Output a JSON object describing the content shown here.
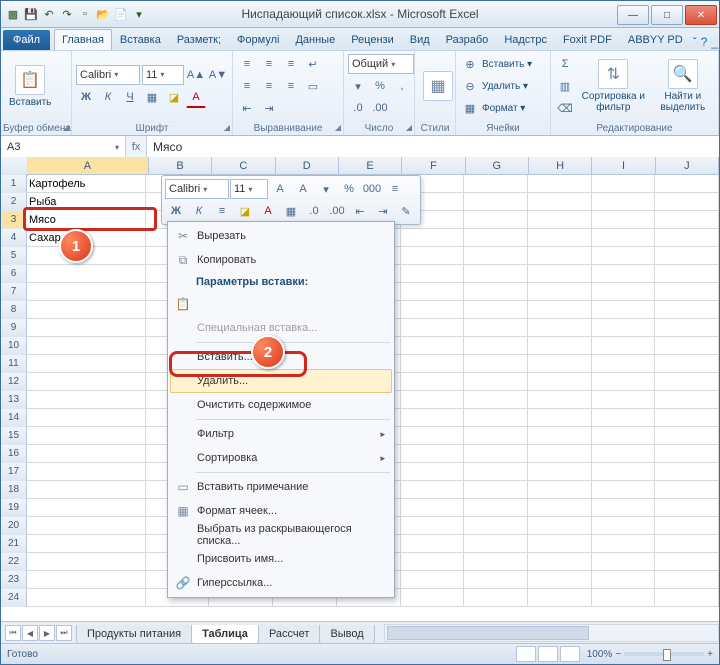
{
  "app": {
    "title": "Ниспадающий список.xlsx - Microsoft Excel"
  },
  "qat": {
    "save": "💾",
    "undo": "↶",
    "redo": "↷",
    "new": "▫",
    "open": "📂",
    "print": "📄"
  },
  "winbtns": {
    "min": "—",
    "max": "□",
    "close": "✕"
  },
  "tabs": {
    "file": "Файл",
    "home": "Главная",
    "insert": "Вставка",
    "layout": "Разметк;",
    "formulas": "Формулі",
    "data": "Данные",
    "review": "Рецензи",
    "view": "Вид",
    "dev": "Разрабо",
    "addins": "Надстрс",
    "foxit": "Foxit PDF",
    "abbyy": "ABBYY PD"
  },
  "help_icons": {
    "help": "?",
    "mdi_min": "_",
    "mdi_max": "□",
    "mdi_close": "✕"
  },
  "ribbon": {
    "clipboard": {
      "label": "Буфер обмена",
      "paste": "Вставить"
    },
    "font": {
      "label": "Шрифт",
      "family": "Calibri",
      "size": "11",
      "bold": "Ж",
      "italic": "К",
      "underline": "Ч",
      "border": "▦",
      "fill": "◪",
      "color": "A",
      "grow": "A▲",
      "shrink": "A▼"
    },
    "align": {
      "label": "Выравнивание",
      "tl": "≡",
      "tc": "≡",
      "tr": "≡",
      "ml": "≡",
      "mc": "≡",
      "mr": "≡",
      "il": "⇤",
      "ir": "⇥",
      "wrap": "↵",
      "merge": "▭"
    },
    "number": {
      "label": "Число",
      "format": "Общий",
      "cur": "%",
      "pct": "%",
      "comma": ",",
      "inc": ".0",
      "dec": ".00"
    },
    "styles": {
      "label": "Стили",
      "cond": "▦",
      "fmt": "▦",
      "cell": "▦"
    },
    "cells": {
      "label": "Ячейки",
      "insert": "Вставить ▾",
      "delete": "Удалить ▾",
      "format": "Формат ▾",
      "ins_ic": "⊕",
      "del_ic": "⊖",
      "fmt_ic": "▦"
    },
    "editing": {
      "label": "Редактирование",
      "sort": "Сортировка и фильтр",
      "find": "Найти и выделить",
      "sort_ic": "⇅",
      "find_ic": "🔍",
      "sum": "Σ",
      "fill": "▥",
      "clear": "⌫"
    }
  },
  "formula": {
    "cellref": "A3",
    "fx": "fx",
    "value": "Мясо"
  },
  "columns": [
    "A",
    "B",
    "C",
    "D",
    "E",
    "F",
    "G",
    "H",
    "I",
    "J"
  ],
  "rows_count": 24,
  "cells": {
    "A1": "Картофель",
    "A2": "Рыба",
    "A3": "Мясо",
    "A4": "Сахар"
  },
  "minibar": {
    "font": "Calibri",
    "size": "11",
    "grow": "A",
    "shrink": "A",
    "acct": "▾",
    "pct": "%",
    "comma": "000",
    "group": "≡",
    "bold": "Ж",
    "italic": "К",
    "align": "≡",
    "fill": "◪",
    "color": "A",
    "border": "▦",
    "dec1": ".0",
    "dec2": ".00",
    "indent1": "⇤",
    "indent2": "⇥",
    "brush": "✎"
  },
  "context": {
    "cut": "Вырезать",
    "copy": "Копировать",
    "paste_opts": "Параметры вставки:",
    "paste_special": "Специальная вставка...",
    "insert": "Вставить...",
    "delete": "Удалить...",
    "clear": "Очистить содержимое",
    "filter": "Фильтр",
    "sort": "Сортировка",
    "comment": "Вставить примечание",
    "format": "Формат ячеек...",
    "picklist": "Выбрать из раскрывающегося списка...",
    "name": "Присвоить имя...",
    "hyperlink": "Гиперссылка...",
    "ic_cut": "✂",
    "ic_copy": "⧉",
    "ic_paste": "📋",
    "ic_comment": "▭",
    "ic_format": "▦",
    "ic_link": "🔗"
  },
  "callouts": {
    "n1": "1",
    "n2": "2"
  },
  "sheets": {
    "s1": "Продукты питания",
    "s2": "Таблица",
    "s3": "Рассчет",
    "s4": "Вывод"
  },
  "status": {
    "ready": "Готово",
    "zoom": "100%",
    "minus": "−",
    "plus": "+"
  }
}
